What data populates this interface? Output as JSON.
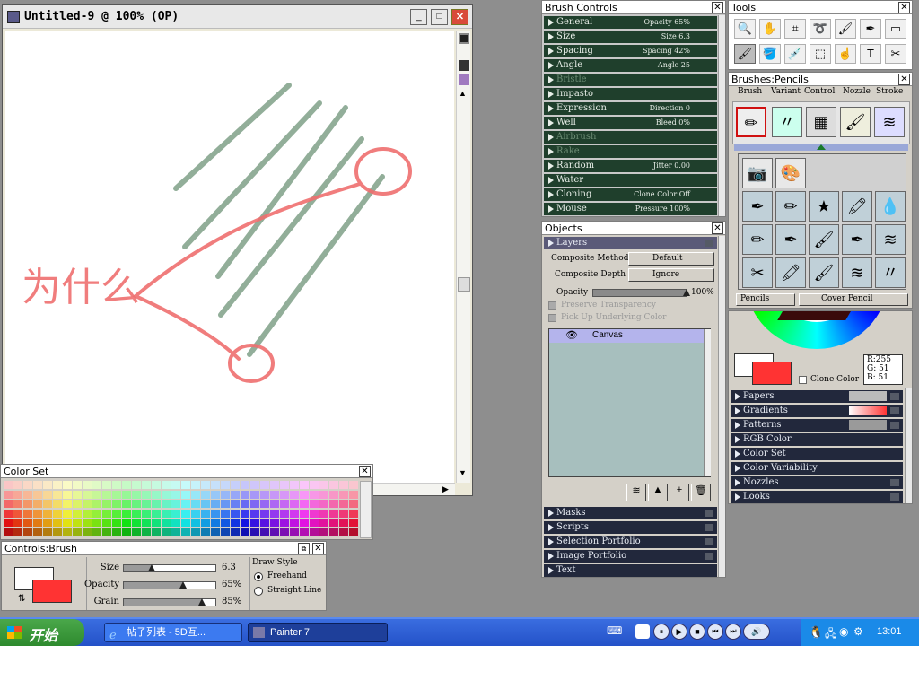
{
  "document": {
    "title": "Untitled-9 @ 100% (OP)"
  },
  "canvas_drawing": {
    "stroke_color": "#ef6f6f",
    "hatch_color": "#7fa088",
    "handwritten_text": "为什么"
  },
  "brush_controls": {
    "title": "Brush Controls",
    "sections": [
      {
        "label": "General",
        "value": "Opacity 65%",
        "dim": false
      },
      {
        "label": "Size",
        "value": "Size 6.3",
        "dim": false
      },
      {
        "label": "Spacing",
        "value": "Spacing 42%",
        "dim": false
      },
      {
        "label": "Angle",
        "value": "Angle 25",
        "dim": false
      },
      {
        "label": "Bristle",
        "value": "",
        "dim": true
      },
      {
        "label": "Impasto",
        "value": "",
        "dim": false
      },
      {
        "label": "Expression",
        "value": "Direction 0",
        "dim": false
      },
      {
        "label": "Well",
        "value": "Bleed 0%",
        "dim": false
      },
      {
        "label": "Airbrush",
        "value": "",
        "dim": true
      },
      {
        "label": "Rake",
        "value": "",
        "dim": true
      },
      {
        "label": "Random",
        "value": "Jitter 0.00",
        "dim": false
      },
      {
        "label": "Water",
        "value": "",
        "dim": false
      },
      {
        "label": "Cloning",
        "value": "Clone Color Off",
        "dim": false
      },
      {
        "label": "Mouse",
        "value": "Pressure 100%",
        "dim": false
      }
    ]
  },
  "tools": {
    "title": "Tools",
    "icons": [
      "magnifier-icon",
      "grabber-icon",
      "crop-icon",
      "lasso-icon",
      "brush-icon",
      "pen-icon",
      "rectangle-icon",
      "brush-active-icon",
      "paint-bucket-icon",
      "dropper-icon",
      "marquee-icon",
      "layer-adjuster-icon",
      "text-icon",
      "scissors-icon"
    ],
    "glyphs": [
      "🔍",
      "✋",
      "⌗",
      "➰",
      "🖌",
      "✒",
      "▭",
      "🖌",
      "🪣",
      "💉",
      "⬚",
      "☝",
      "T",
      "✂"
    ]
  },
  "brushes": {
    "title": "Brushes:Pencils",
    "tabs": [
      "Brush",
      "Variant",
      "Control",
      "Nozzle",
      "Stroke"
    ],
    "category": "Pencils",
    "variant": "Cover Pencil"
  },
  "objects": {
    "title": "Objects",
    "section": "Layers",
    "composite_method_label": "Composite Method",
    "composite_method_value": "Default",
    "composite_depth_label": "Composite Depth",
    "composite_depth_value": "Ignore",
    "opacity_label": "Opacity",
    "opacity_value": "100%",
    "opacity_level": 1.0,
    "preserve_transparency": "Preserve Transparency",
    "pick_up_underlying": "Pick Up Underlying Color",
    "layer_name": "Canvas",
    "bottom_sections": [
      "Masks",
      "Scripts",
      "Selection Portfolio",
      "Image Portfolio",
      "Text"
    ]
  },
  "color_panel": {
    "r": "R:255",
    "g": "G: 51",
    "b": "B: 51",
    "clone_color": "Clone Color",
    "primary_color": "#ff3333",
    "secondary_color": "#ffffff",
    "sections": [
      "Papers",
      "Gradients",
      "Patterns",
      "RGB Color",
      "Color Set",
      "Color Variability",
      "Nozzles",
      "Looks"
    ]
  },
  "color_set": {
    "title": "Color Set"
  },
  "controls_brush": {
    "title": "Controls:Brush",
    "size_label": "Size",
    "size_value": "6.3",
    "size_level": 0.3,
    "opacity_label": "Opacity",
    "opacity_value": "65%",
    "opacity_level": 0.65,
    "grain_label": "Grain",
    "grain_value": "85%",
    "grain_level": 0.85,
    "draw_style_label": "Draw Style",
    "freehand_label": "Freehand",
    "straight_line_label": "Straight Line"
  },
  "taskbar": {
    "start_label": "开始",
    "task1": "帖子列表 - 5D互...",
    "task2": "Painter 7",
    "clock": "13:01"
  }
}
